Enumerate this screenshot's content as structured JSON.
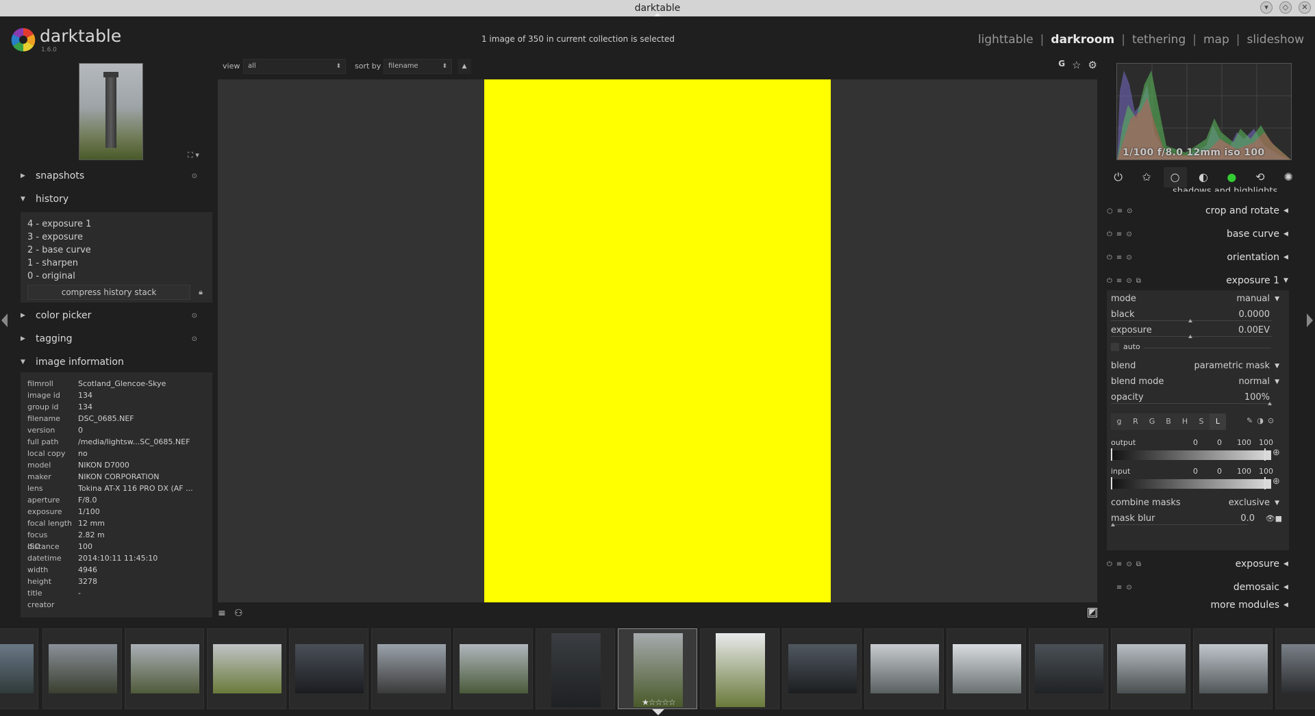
{
  "window": {
    "title": "darktable"
  },
  "app": {
    "name": "darktable",
    "version": "1.6.0"
  },
  "header": {
    "status": "1 image of 350 in current collection is selected"
  },
  "views": [
    {
      "label": "lighttable",
      "active": false
    },
    {
      "label": "darkroom",
      "active": true
    },
    {
      "label": "tethering",
      "active": false
    },
    {
      "label": "map",
      "active": false
    },
    {
      "label": "slideshow",
      "active": false
    }
  ],
  "toolbar": {
    "view_label": "view",
    "view_value": "all",
    "sort_label": "sort by",
    "sort_value": "filename",
    "grouping_label": "G"
  },
  "left": {
    "snapshots": "snapshots",
    "history": "history",
    "history_items": [
      "4 - exposure 1",
      "3 - exposure",
      "2 - base curve",
      "1 - sharpen",
      "0 - original"
    ],
    "compress": "compress history stack",
    "color_picker": "color picker",
    "tagging": "tagging",
    "image_information": "image information",
    "info": [
      [
        "filmroll",
        "Scotland_Glencoe-Skye"
      ],
      [
        "image id",
        "134"
      ],
      [
        "group id",
        "134"
      ],
      [
        "filename",
        "DSC_0685.NEF"
      ],
      [
        "version",
        "0"
      ],
      [
        "full path",
        "/media/lightsw...SC_0685.NEF"
      ],
      [
        "local copy",
        "no"
      ],
      [
        "model",
        "NIKON D7000"
      ],
      [
        "maker",
        "NIKON CORPORATION"
      ],
      [
        "lens",
        "Tokina AT-X 116 PRO DX (AF ..."
      ],
      [
        "aperture",
        "F/8.0"
      ],
      [
        "exposure",
        "1/100"
      ],
      [
        "focal length",
        "12 mm"
      ],
      [
        "focus distance",
        "2.82 m"
      ],
      [
        "ISO",
        "100"
      ],
      [
        "datetime",
        "2014:10:11 11:45:10"
      ],
      [
        "width",
        "4946"
      ],
      [
        "height",
        "3278"
      ],
      [
        "title",
        "-"
      ],
      [
        "creator",
        ""
      ]
    ]
  },
  "right": {
    "histogram_info": "1/100 f/8.0 12mm iso 100",
    "hidden_module": "shadows and highlights",
    "modules": [
      {
        "name": "crop and rotate"
      },
      {
        "name": "base curve"
      },
      {
        "name": "orientation"
      },
      {
        "name": "exposure 1"
      },
      {
        "name": "exposure"
      },
      {
        "name": "demosaic"
      }
    ],
    "more_modules": "more modules",
    "exposure": {
      "mode_label": "mode",
      "mode_value": "manual",
      "black_label": "black",
      "black_value": "0.0000",
      "exposure_label": "exposure",
      "exposure_value": "0.00EV",
      "auto_label": "auto",
      "blend_label": "blend",
      "blend_value": "parametric mask",
      "blend_mode_label": "blend mode",
      "blend_mode_value": "normal",
      "opacity_label": "opacity",
      "opacity_value": "100%",
      "channels": [
        "g",
        "R",
        "G",
        "B",
        "H",
        "S",
        "L"
      ],
      "output_label": "output",
      "output_values": [
        "0",
        "0",
        "100",
        "100"
      ],
      "input_label": "input",
      "input_values": [
        "0",
        "0",
        "100",
        "100"
      ],
      "combine_label": "combine masks",
      "combine_value": "exclusive",
      "mask_blur_label": "mask blur",
      "mask_blur_value": "0.0"
    }
  },
  "colors": {
    "image": "#ffff00",
    "background": "#1f1f1f",
    "canvas": "#333333"
  }
}
